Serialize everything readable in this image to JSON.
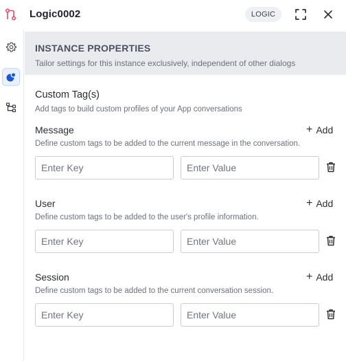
{
  "header": {
    "title": "Logic0002",
    "badge": "LOGIC",
    "logo_icon": "flow-branch-icon",
    "expand_icon": "expand-icon",
    "close_icon": "close-icon",
    "accent_color": "#e8496b"
  },
  "sidebar": {
    "items": [
      {
        "icon": "gear-icon",
        "active": false
      },
      {
        "icon": "instance-properties-icon",
        "active": true
      },
      {
        "icon": "flow-tree-icon",
        "active": false
      }
    ],
    "active_color": "#1a56db"
  },
  "instance_properties": {
    "title": "INSTANCE PROPERTIES",
    "subtitle": "Tailor settings for this instance exclusively, independent of other dialogs"
  },
  "custom_tags": {
    "title": "Custom Tag(s)",
    "subtitle": "Add tags to build custom profiles of your App conversations"
  },
  "sections": [
    {
      "title": "Message",
      "description": "Define custom tags to be added to the current message in the conversation.",
      "add_label": "Add",
      "key_placeholder": "Enter Key",
      "value_placeholder": "Enter Value",
      "key_value": "",
      "value_value": ""
    },
    {
      "title": "User",
      "description": "Define custom tags to be added to the user's profile information.",
      "add_label": "Add",
      "key_placeholder": "Enter Key",
      "value_placeholder": "Enter Value",
      "key_value": "",
      "value_value": ""
    },
    {
      "title": "Session",
      "description": "Define custom tags to be added to the current conversation session.",
      "add_label": "Add",
      "key_placeholder": "Enter Key",
      "value_placeholder": "Enter Value",
      "key_value": "",
      "value_value": ""
    }
  ]
}
